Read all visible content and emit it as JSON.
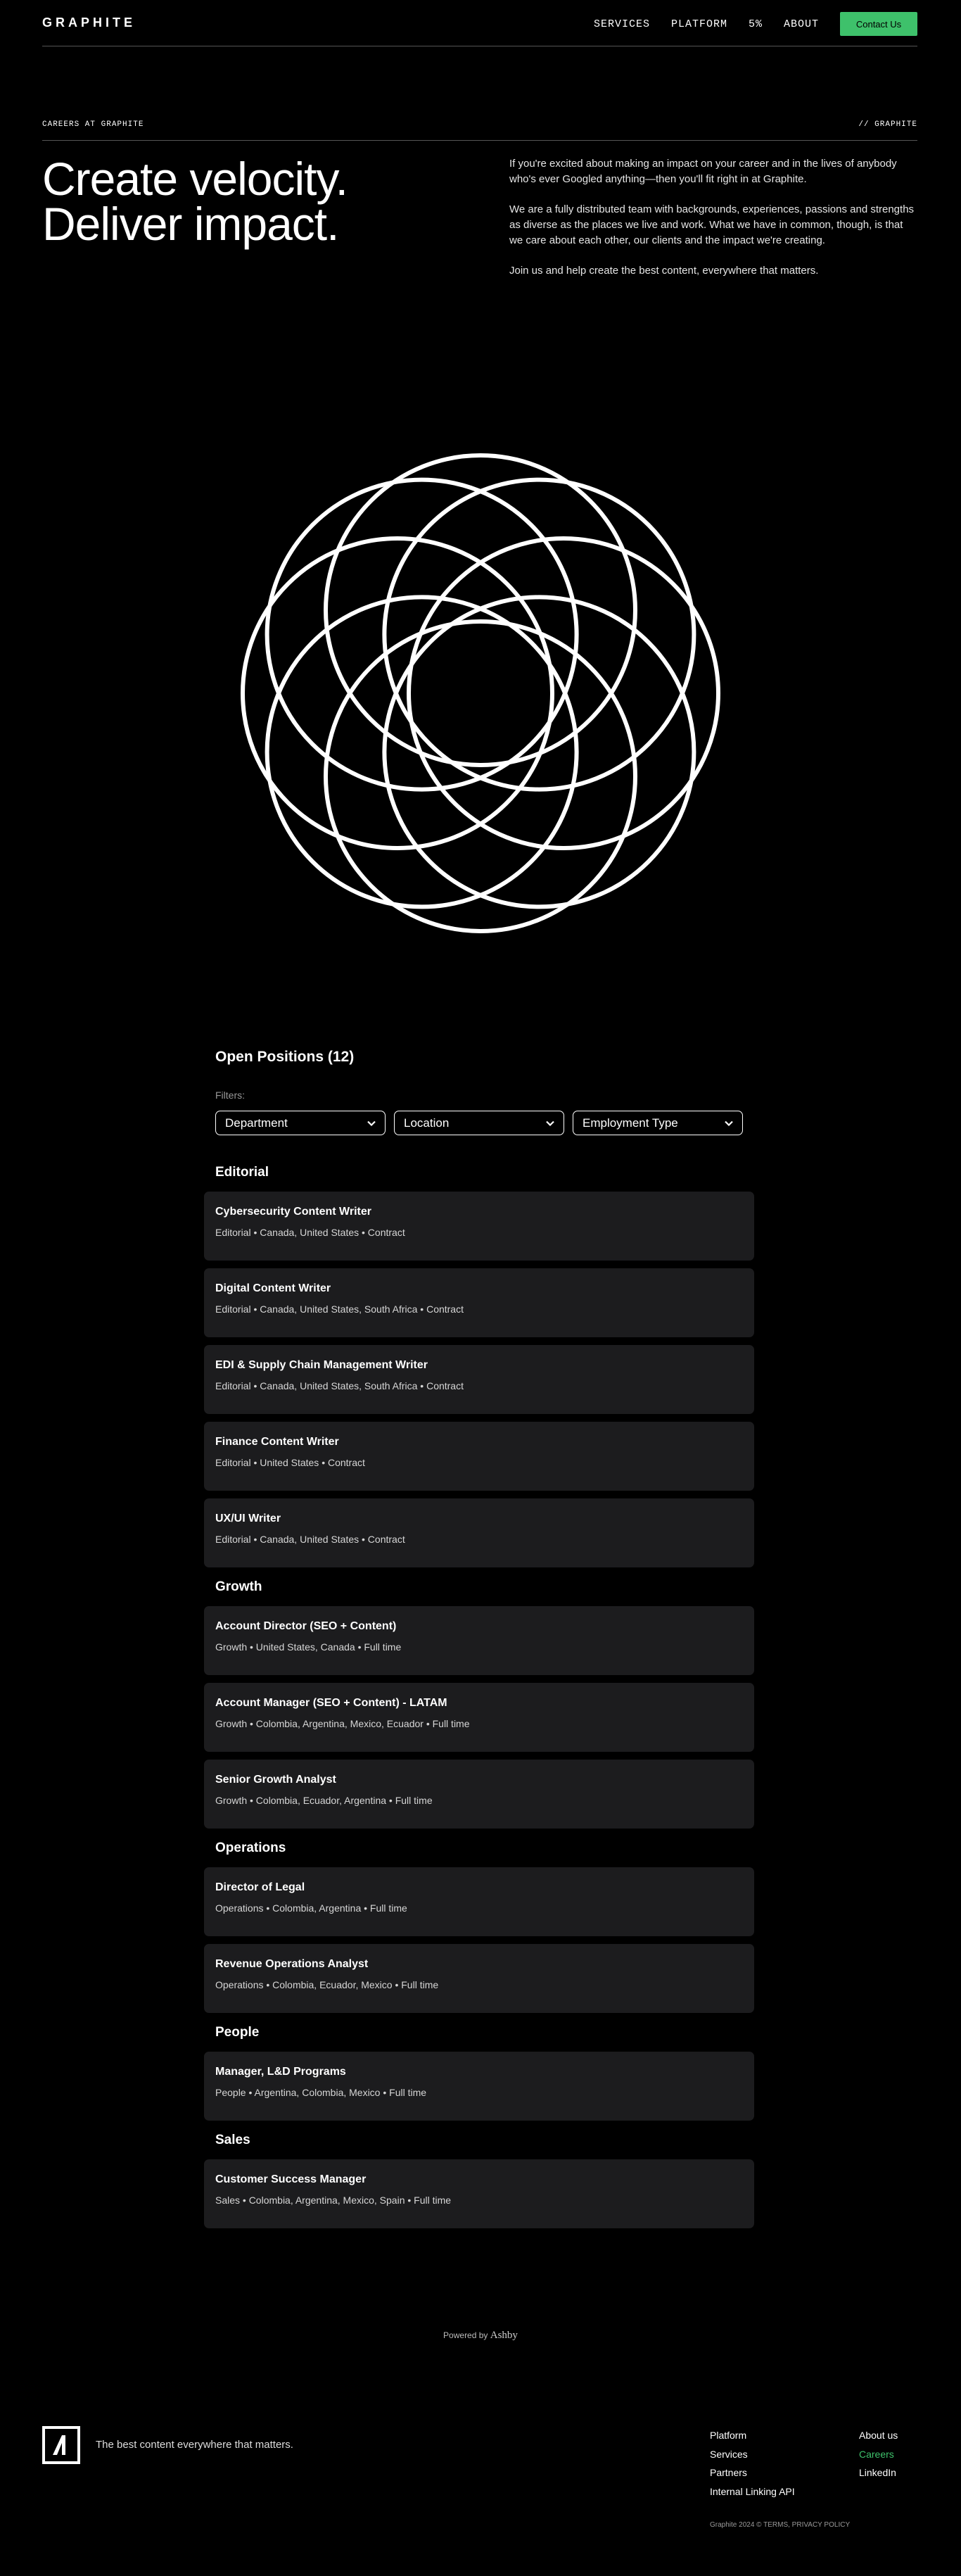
{
  "header": {
    "logo": "GRAPHITE",
    "nav": [
      "SERVICES",
      "PLATFORM",
      "5%",
      "ABOUT"
    ],
    "contact": "Contact Us"
  },
  "hero": {
    "eyebrow": "CAREERS AT GRAPHITE",
    "eyebrow_right": "// GRAPHITE",
    "title_line1": "Create velocity.",
    "title_line2": "Deliver impact.",
    "paragraphs": [
      "If you're excited about making an impact on your career and in the lives of anybody who's ever Googled anything—then you'll fit right in at Graphite.",
      "We are a fully distributed team with backgrounds, experiences, passions and strengths as diverse as the places we live and work. What we have in common, though, is that we care about each other, our clients and the impact we're creating.",
      "Join us and help create the best content, everywhere that matters."
    ]
  },
  "positions": {
    "title": "Open Positions (12)",
    "filters_label": "Filters:",
    "filters": [
      "Department",
      "Location",
      "Employment Type"
    ],
    "departments": [
      {
        "name": "Editorial",
        "jobs": [
          {
            "title": "Cybersecurity Content Writer",
            "meta": "Editorial • Canada, United States • Contract"
          },
          {
            "title": "Digital Content Writer",
            "meta": "Editorial • Canada, United States, South Africa • Contract"
          },
          {
            "title": "EDI & Supply Chain Management Writer",
            "meta": "Editorial • Canada, United States, South Africa • Contract"
          },
          {
            "title": "Finance Content Writer",
            "meta": "Editorial • United States • Contract"
          },
          {
            "title": "UX/UI Writer",
            "meta": "Editorial • Canada, United States • Contract"
          }
        ]
      },
      {
        "name": "Growth",
        "jobs": [
          {
            "title": "Account Director (SEO + Content)",
            "meta": "Growth • United States, Canada • Full time"
          },
          {
            "title": "Account Manager (SEO + Content) - LATAM",
            "meta": "Growth • Colombia, Argentina, Mexico, Ecuador • Full time"
          },
          {
            "title": "Senior Growth Analyst",
            "meta": "Growth • Colombia, Ecuador, Argentina • Full time"
          }
        ]
      },
      {
        "name": "Operations",
        "jobs": [
          {
            "title": "Director of Legal",
            "meta": "Operations • Colombia, Argentina • Full time"
          },
          {
            "title": "Revenue Operations Analyst",
            "meta": "Operations • Colombia, Ecuador, Mexico • Full time"
          }
        ]
      },
      {
        "name": "People",
        "jobs": [
          {
            "title": "Manager, L&D Programs",
            "meta": "People • Argentina, Colombia, Mexico • Full time"
          }
        ]
      },
      {
        "name": "Sales",
        "jobs": [
          {
            "title": "Customer Success Manager",
            "meta": "Sales • Colombia, Argentina, Mexico, Spain • Full time"
          }
        ]
      }
    ]
  },
  "powered": {
    "prefix": "Powered by",
    "brand": "Ashby"
  },
  "footer": {
    "tagline": "The best content everywhere that matters.",
    "col1": [
      "Platform",
      "Services",
      "Partners",
      "Internal Linking API"
    ],
    "col2": [
      "About us",
      "Careers",
      "LinkedIn"
    ],
    "copyright": "Graphite 2024 © TERMS, PRIVACY POLICY"
  },
  "colors": {
    "accent": "#3ec16b",
    "card": "#1c1c1e",
    "background": "#000000"
  }
}
